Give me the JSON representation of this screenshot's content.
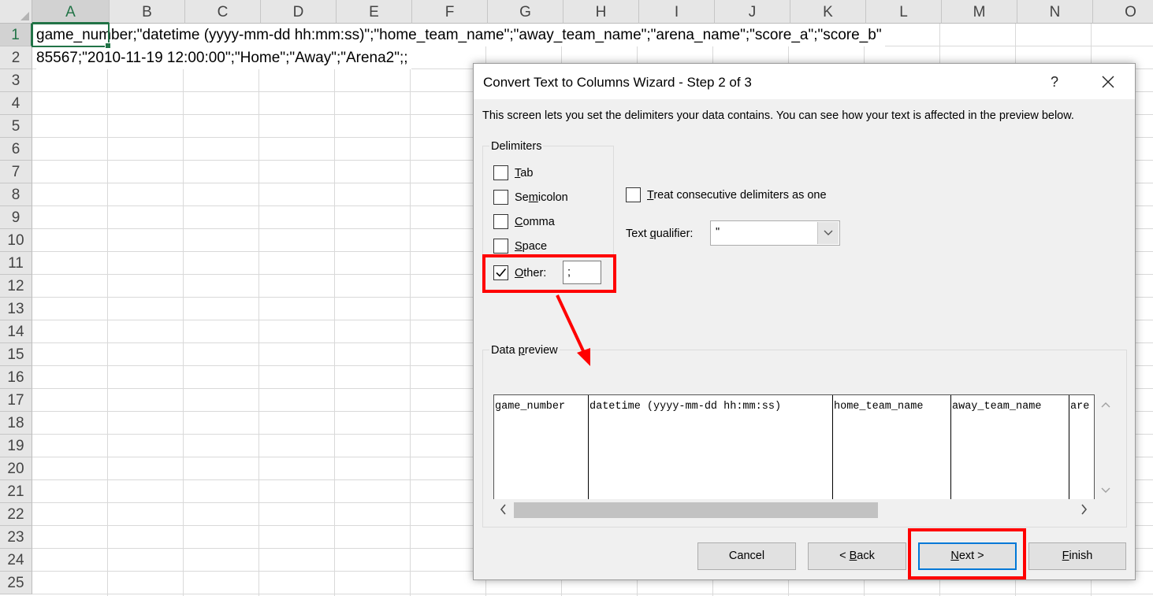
{
  "sheet": {
    "columns": [
      "A",
      "B",
      "C",
      "D",
      "E",
      "F",
      "G",
      "H",
      "I",
      "J",
      "K",
      "L",
      "M",
      "N",
      "O"
    ],
    "rows": [
      "1",
      "2",
      "3",
      "4",
      "5",
      "6",
      "7",
      "8",
      "9",
      "10",
      "11",
      "12",
      "13",
      "14",
      "15",
      "16",
      "17",
      "18",
      "19",
      "20",
      "21",
      "22",
      "23",
      "24",
      "25"
    ],
    "selected_column": "A",
    "selected_row": "1",
    "cells": {
      "a1": "game_number;\"datetime (yyyy-mm-dd hh:mm:ss)\";\"home_team_name\";\"away_team_name\";\"arena_name\";\"score_a\";\"score_b\"",
      "a2": "85567;\"2010-11-19 12:00:00\";\"Home\";\"Away\";\"Arena2\";;"
    }
  },
  "dialog": {
    "title": "Convert Text to Columns Wizard - Step 2 of 3",
    "help": "?",
    "description": "This screen lets you set the delimiters your data contains.  You can see how your text is affected in the preview below.",
    "delimiters_legend": "Delimiters",
    "delimiters": {
      "tab": {
        "pre": "",
        "key": "T",
        "post": "ab",
        "checked": false
      },
      "semicolon": {
        "pre": "Se",
        "key": "m",
        "post": "icolon",
        "checked": false
      },
      "comma": {
        "pre": "",
        "key": "C",
        "post": "omma",
        "checked": false
      },
      "space": {
        "pre": "",
        "key": "S",
        "post": "pace",
        "checked": false
      },
      "other": {
        "pre": "",
        "key": "O",
        "post": "ther:",
        "checked": true,
        "value": ";"
      }
    },
    "consecutive": {
      "pre": "",
      "key": "T",
      "post": "reat consecutive delimiters as one",
      "checked": false
    },
    "qualifier": {
      "pre": "Text ",
      "key": "q",
      "post": "ualifier:",
      "value": "\""
    },
    "preview_legend": {
      "pre": "Data ",
      "key": "p",
      "post": "review"
    },
    "preview_columns": [
      "game_number",
      "datetime (yyyy-mm-dd hh:mm:ss)",
      "home_team_name",
      "away_team_name",
      "are"
    ],
    "buttons": {
      "cancel": "Cancel",
      "back": {
        "pre": "< ",
        "key": "B",
        "post": "ack"
      },
      "next": {
        "pre": "",
        "key": "N",
        "post": "ext >"
      },
      "finish": {
        "pre": "",
        "key": "F",
        "post": "inish"
      }
    }
  },
  "annotation_color": "#ff0000",
  "accent_color": "#217346"
}
